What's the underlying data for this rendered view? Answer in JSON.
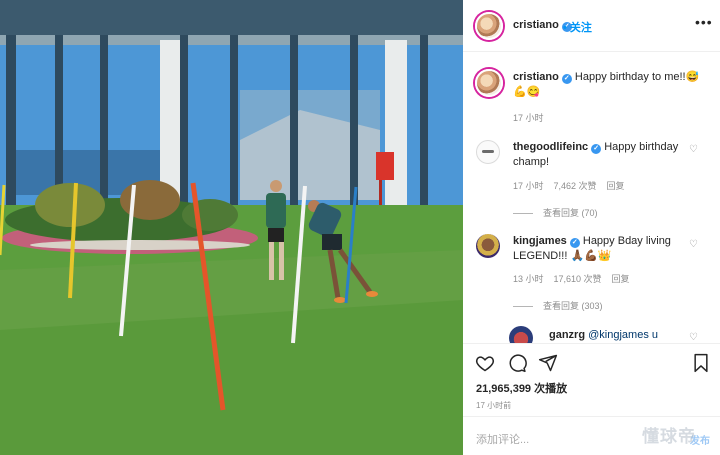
{
  "header": {
    "username": "cristiano",
    "follow_label": "• 关注",
    "more_icon": "more-horizontal-icon"
  },
  "caption": {
    "username": "cristiano",
    "text": "Happy birthday to me!!😅💪😋",
    "time": "17 小时"
  },
  "comments": [
    {
      "username": "thegoodlifeinc",
      "text": "Happy birthday champ!",
      "time": "17 小时",
      "likes": "7,462 次赞",
      "reply_label": "回复",
      "view_replies": "查看回复 (70)"
    },
    {
      "username": "kingjames",
      "text": "Happy Bday living LEGEND!!! 🙏🏾💪🏾👑",
      "time": "13 小时",
      "likes": "17,610 次赞",
      "reply_label": "回复",
      "view_replies": "查看回复 (303)"
    },
    {
      "username": "ganzrg",
      "text": "@kingjames u"
    }
  ],
  "actions": {
    "like_icon": "heart-icon",
    "comment_icon": "comment-icon",
    "share_icon": "share-icon",
    "save_icon": "bookmark-icon"
  },
  "stats": {
    "views": "21,965,399 次播放",
    "posted": "17 小时前"
  },
  "add_comment": {
    "placeholder": "添加评论...",
    "post_label": "发布"
  },
  "watermark": "懂球帝",
  "colors": {
    "link_blue": "#0095f6",
    "verified_blue": "#3897f0",
    "grass": "#5c9e3e",
    "story_ring": "#d6249f"
  }
}
